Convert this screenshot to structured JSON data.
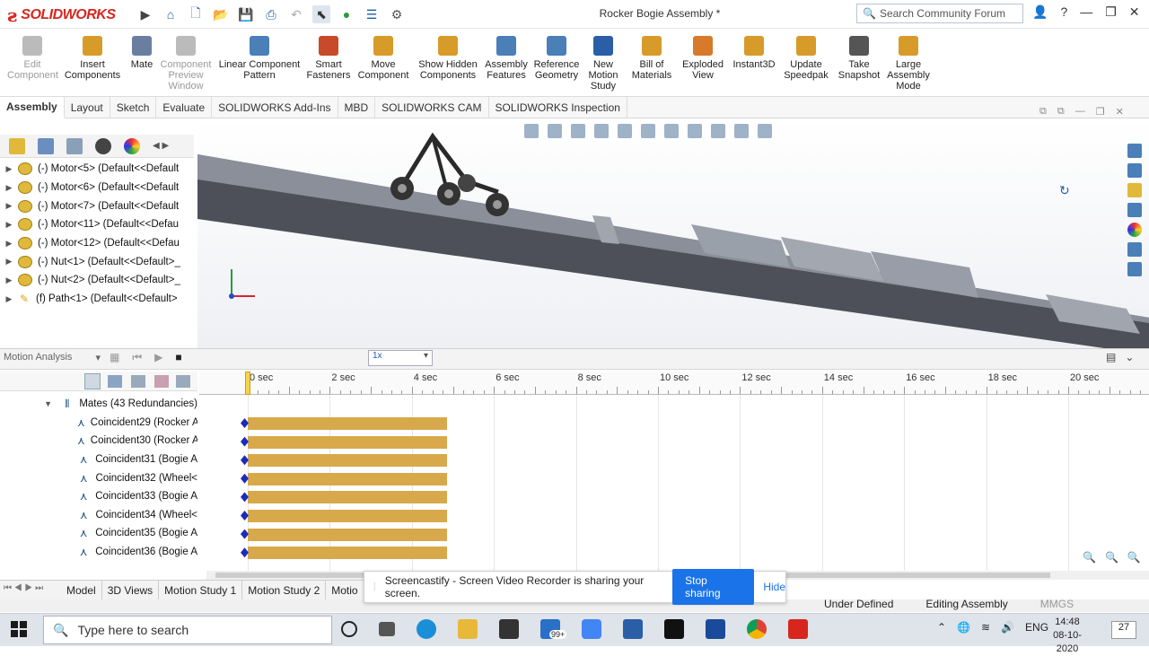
{
  "app": {
    "logo_text": "SOLIDWORKS",
    "document_title": "Rocker Bogie Assembly *",
    "search_placeholder": "Search Community Forum"
  },
  "ribbon": [
    {
      "label": "Edit Component",
      "disabled": true
    },
    {
      "label": "Insert Components",
      "disabled": false
    },
    {
      "label": "Mate",
      "disabled": false
    },
    {
      "label": "Component Preview Window",
      "disabled": true
    },
    {
      "label": "Linear Component Pattern",
      "disabled": false
    },
    {
      "label": "Smart Fasteners",
      "disabled": false
    },
    {
      "label": "Move Component",
      "disabled": false
    },
    {
      "label": "Show Hidden Components",
      "disabled": false
    },
    {
      "label": "Assembly Features",
      "disabled": false
    },
    {
      "label": "Reference Geometry",
      "disabled": false
    },
    {
      "label": "New Motion Study",
      "disabled": false
    },
    {
      "label": "Bill of Materials",
      "disabled": false
    },
    {
      "label": "Exploded View",
      "disabled": false
    },
    {
      "label": "Instant3D",
      "disabled": false
    },
    {
      "label": "Update Speedpak",
      "disabled": false
    },
    {
      "label": "Take Snapshot",
      "disabled": false
    },
    {
      "label": "Large Assembly Mode",
      "disabled": false
    }
  ],
  "command_tabs": [
    "Assembly",
    "Layout",
    "Sketch",
    "Evaluate",
    "SOLIDWORKS Add-Ins",
    "MBD",
    "SOLIDWORKS CAM",
    "SOLIDWORKS Inspection"
  ],
  "feature_tree": [
    "(-) Motor<5> (Default<<Default",
    "(-) Motor<6> (Default<<Default",
    "(-) Motor<7> (Default<<Default",
    "(-) Motor<11> (Default<<Defau",
    "(-) Motor<12> (Default<<Defau",
    "(-) Nut<1> (Default<<Default>_",
    "(-) Nut<2> (Default<<Default>_",
    "(f) Path<1> (Default<<Default>"
  ],
  "motion": {
    "study_type": "Motion Analysis",
    "speed": "1x",
    "mates_group": "Mates (43 Redundancies)",
    "mates": [
      "Coincident29 (Rocker A",
      "Coincident30 (Rocker A",
      "Coincident31 (Bogie A",
      "Coincident32 (Wheel<",
      "Coincident33 (Bogie A",
      "Coincident34 (Wheel<",
      "Coincident35 (Bogie A",
      "Coincident36 (Bogie A"
    ],
    "ruler": [
      "0 sec",
      "2 sec",
      "4 sec",
      "6 sec",
      "8 sec",
      "10 sec",
      "12 sec",
      "14 sec",
      "16 sec",
      "18 sec",
      "20 sec"
    ],
    "bar_end_sec": 4.85,
    "colors": {
      "bar": "#d8a94a",
      "key": "#1a2cb8"
    }
  },
  "bottom_tabs": [
    "Model",
    "3D Views",
    "Motion Study 1",
    "Motion Study 2",
    "Motio"
  ],
  "screencastify": {
    "message": "Screencastify - Screen Video Recorder is sharing your screen.",
    "stop_label": "Stop sharing",
    "hide_label": "Hide"
  },
  "status": {
    "left": "Under Defined",
    "right": "Editing Assembly",
    "units": "MMGS"
  },
  "taskbar": {
    "search_placeholder": "Type here to search",
    "mail_badge": "99+",
    "language": "ENG",
    "time": "14:48",
    "date": "08-10-2020",
    "notif_count": "27"
  }
}
